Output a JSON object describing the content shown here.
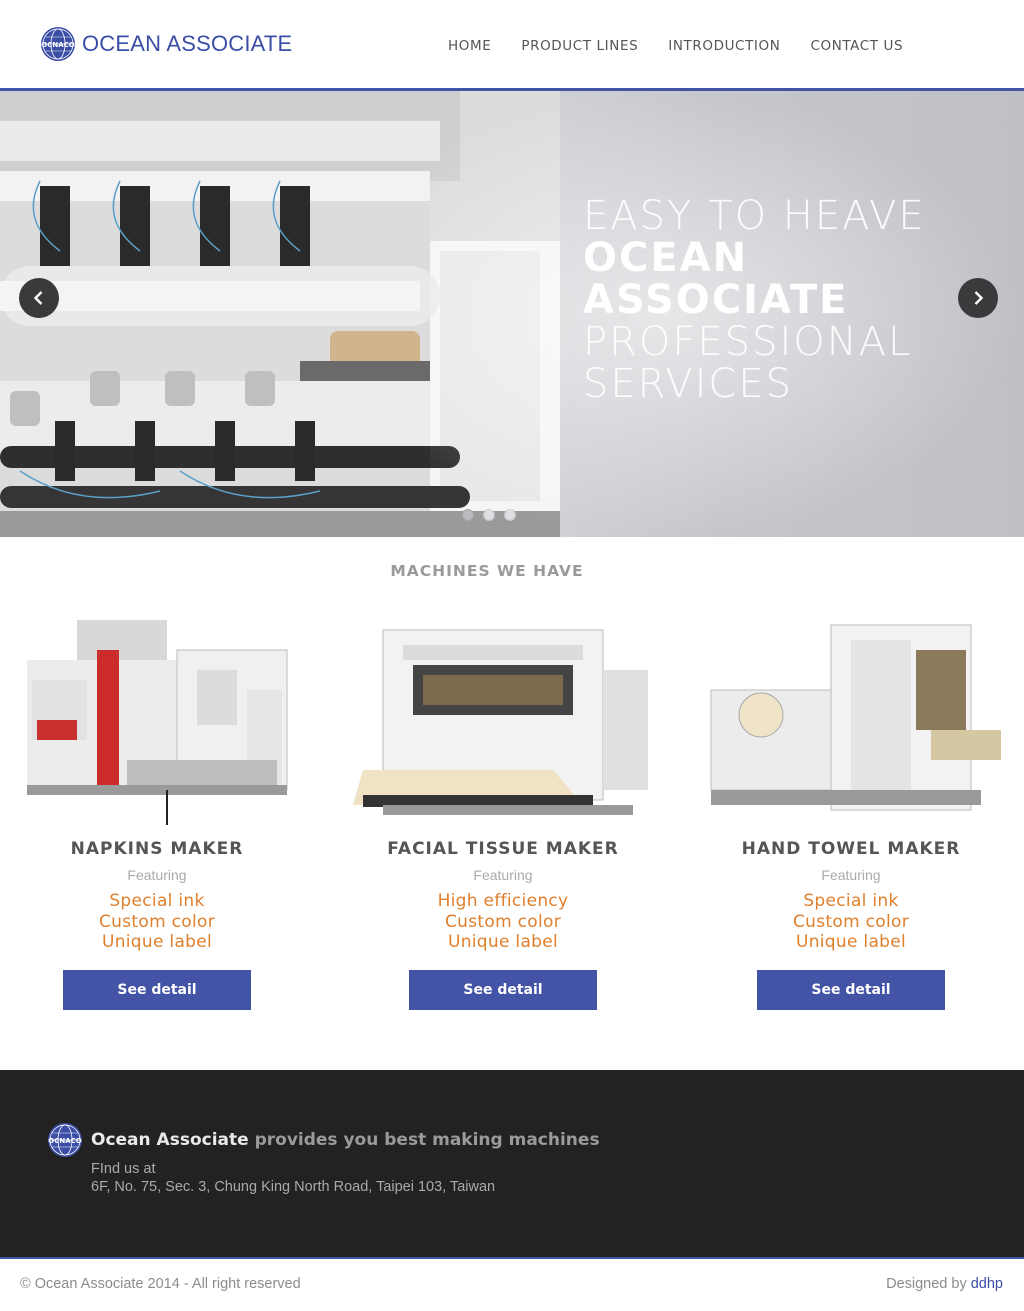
{
  "brand": {
    "name": "OCEAN ASSOCIATE",
    "mark_text": "OCNACO",
    "color": "#3a4ea6"
  },
  "nav": [
    {
      "label": "HOME"
    },
    {
      "label": "PRODUCT LINES"
    },
    {
      "label": "INTRODUCTION"
    },
    {
      "label": "CONTACT US"
    }
  ],
  "hero": {
    "line1": "EASY TO HEAVE",
    "line2": "OCEAN",
    "line3": "ASSOCIATE",
    "line4": "PROFESSIONAL",
    "line5": "SERVICES",
    "prev_icon": "chevron-left-icon",
    "next_icon": "chevron-right-icon",
    "slide_count": 3,
    "active_slide": 1
  },
  "machines": {
    "title": "MACHINES WE HAVE",
    "items": [
      {
        "name": "NAPKINS MAKER",
        "featuring": "Featuring",
        "features": [
          "Special ink",
          "Custom color",
          "Unique label"
        ],
        "button": "See detail"
      },
      {
        "name": "FACIAL TISSUE MAKER",
        "featuring": "Featuring",
        "features": [
          "High efficiency",
          "Custom color",
          "Unique label"
        ],
        "button": "See detail"
      },
      {
        "name": "HAND TOWEL MAKER",
        "featuring": "Featuring",
        "features": [
          "Special ink",
          "Custom color",
          "Unique label"
        ],
        "button": "See detail"
      }
    ]
  },
  "footer": {
    "brand": "Ocean Associate",
    "tagline": " provides you best making machines",
    "find_label": "FInd us at",
    "address": "6F, No. 75, Sec. 3, Chung King North Road, Taipei 103, Taiwan",
    "copyright": "© Ocean Associate 2014 - All right reserved",
    "designed_by": "Designed by ",
    "designer": "ddhp"
  },
  "colors": {
    "accent": "#4353a5",
    "feature_text": "#e07f2c",
    "footer_bg": "#222222"
  }
}
